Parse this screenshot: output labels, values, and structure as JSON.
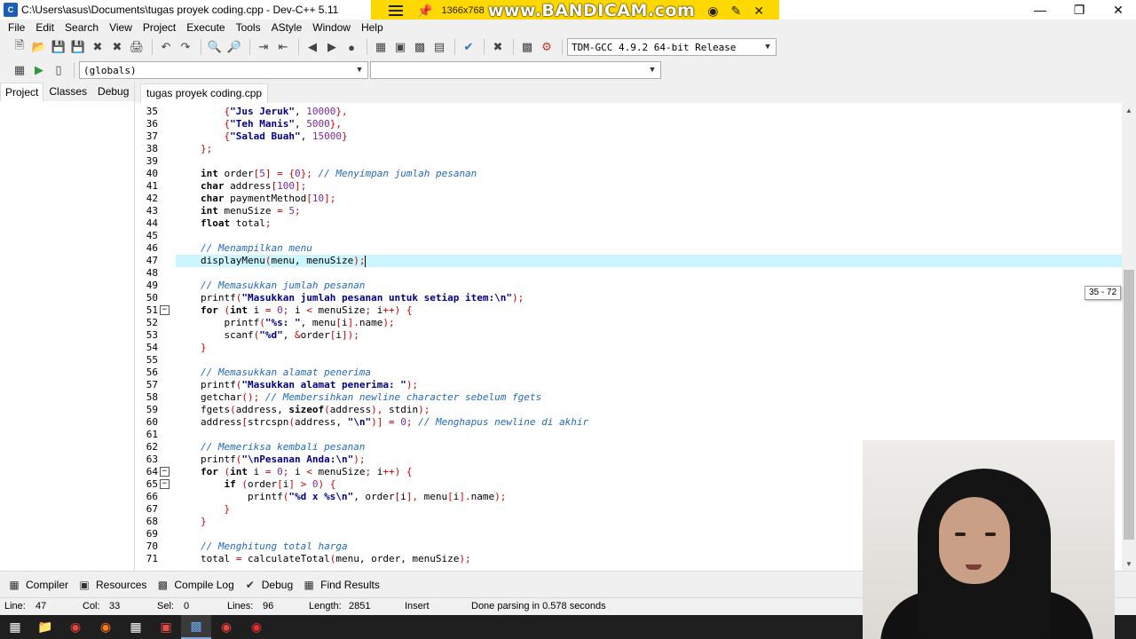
{
  "window": {
    "title": "C:\\Users\\asus\\Documents\\tugas proyek coding.cpp - Dev-C++ 5.11",
    "minimize": "—",
    "maximize": "❐",
    "close": "✕"
  },
  "recorder": {
    "resolution": "1366x768",
    "brand": "www.BANDICAM.com"
  },
  "menu": [
    "File",
    "Edit",
    "Search",
    "View",
    "Project",
    "Execute",
    "Tools",
    "AStyle",
    "Window",
    "Help"
  ],
  "toolbar": {
    "compiler_select": "TDM-GCC 4.9.2 64-bit Release",
    "scope_select": "(globals)",
    "symbol_select": ""
  },
  "left_panel": {
    "tabs": [
      "Project",
      "Classes",
      "Debug"
    ],
    "active_tab": "Project"
  },
  "editor": {
    "file_tab": "tugas proyek coding.cpp",
    "current_line": 47,
    "scroll_tooltip": "35 - 72",
    "lines": [
      {
        "n": 35,
        "indent": 4,
        "fold": "",
        "tokens": [
          {
            "t": "{",
            "c": "sym"
          },
          {
            "t": "\"Jus Jeruk\"",
            "c": "str"
          },
          {
            "t": ", ",
            "c": ""
          },
          {
            "t": "10000",
            "c": "num"
          },
          {
            "t": "},",
            "c": "sym"
          }
        ]
      },
      {
        "n": 36,
        "indent": 4,
        "fold": "",
        "tokens": [
          {
            "t": "{",
            "c": "sym"
          },
          {
            "t": "\"Teh Manis\"",
            "c": "str"
          },
          {
            "t": ", ",
            "c": ""
          },
          {
            "t": "5000",
            "c": "num"
          },
          {
            "t": "},",
            "c": "sym"
          }
        ]
      },
      {
        "n": 37,
        "indent": 4,
        "fold": "",
        "tokens": [
          {
            "t": "{",
            "c": "sym"
          },
          {
            "t": "\"Salad Buah\"",
            "c": "str"
          },
          {
            "t": ", ",
            "c": ""
          },
          {
            "t": "15000",
            "c": "num"
          },
          {
            "t": "}",
            "c": "sym"
          }
        ]
      },
      {
        "n": 38,
        "indent": 0,
        "fold": "",
        "tokens": [
          {
            "t": "};",
            "c": "sym"
          }
        ]
      },
      {
        "n": 39,
        "indent": 0,
        "fold": "",
        "tokens": []
      },
      {
        "n": 40,
        "indent": 0,
        "fold": "",
        "tokens": [
          {
            "t": "int",
            "c": "kw"
          },
          {
            "t": " order",
            "c": ""
          },
          {
            "t": "[",
            "c": "sym"
          },
          {
            "t": "5",
            "c": "num"
          },
          {
            "t": "] = {",
            "c": "sym"
          },
          {
            "t": "0",
            "c": "num"
          },
          {
            "t": "};",
            "c": "sym"
          },
          {
            "t": " // Menyimpan jumlah pesanan",
            "c": "cm"
          }
        ]
      },
      {
        "n": 41,
        "indent": 0,
        "fold": "",
        "tokens": [
          {
            "t": "char",
            "c": "kw"
          },
          {
            "t": " address",
            "c": ""
          },
          {
            "t": "[",
            "c": "sym"
          },
          {
            "t": "100",
            "c": "num"
          },
          {
            "t": "];",
            "c": "sym"
          }
        ]
      },
      {
        "n": 42,
        "indent": 0,
        "fold": "",
        "tokens": [
          {
            "t": "char",
            "c": "kw"
          },
          {
            "t": " paymentMethod",
            "c": ""
          },
          {
            "t": "[",
            "c": "sym"
          },
          {
            "t": "10",
            "c": "num"
          },
          {
            "t": "];",
            "c": "sym"
          }
        ]
      },
      {
        "n": 43,
        "indent": 0,
        "fold": "",
        "tokens": [
          {
            "t": "int",
            "c": "kw"
          },
          {
            "t": " menuSize ",
            "c": ""
          },
          {
            "t": "=",
            "c": "sym"
          },
          {
            "t": " ",
            "c": ""
          },
          {
            "t": "5",
            "c": "num"
          },
          {
            "t": ";",
            "c": "sym"
          }
        ]
      },
      {
        "n": 44,
        "indent": 0,
        "fold": "",
        "tokens": [
          {
            "t": "float",
            "c": "kw"
          },
          {
            "t": " total",
            "c": ""
          },
          {
            "t": ";",
            "c": "sym"
          }
        ]
      },
      {
        "n": 45,
        "indent": 0,
        "fold": "",
        "tokens": []
      },
      {
        "n": 46,
        "indent": 0,
        "fold": "",
        "tokens": [
          {
            "t": "// Menampilkan menu",
            "c": "cm"
          }
        ]
      },
      {
        "n": 47,
        "indent": 0,
        "fold": "",
        "tokens": [
          {
            "t": "displayMenu",
            "c": ""
          },
          {
            "t": "(",
            "c": "sym"
          },
          {
            "t": "menu, menuSize",
            "c": ""
          },
          {
            "t": ");",
            "c": "sym"
          }
        ]
      },
      {
        "n": 48,
        "indent": 0,
        "fold": "",
        "tokens": []
      },
      {
        "n": 49,
        "indent": 0,
        "fold": "",
        "tokens": [
          {
            "t": "// Memasukkan jumlah pesanan",
            "c": "cm"
          }
        ]
      },
      {
        "n": 50,
        "indent": 0,
        "fold": "",
        "tokens": [
          {
            "t": "printf",
            "c": ""
          },
          {
            "t": "(",
            "c": "sym"
          },
          {
            "t": "\"Masukkan jumlah pesanan untuk setiap item:\\n\"",
            "c": "str"
          },
          {
            "t": ");",
            "c": "sym"
          }
        ]
      },
      {
        "n": 51,
        "indent": 0,
        "fold": "−",
        "tokens": [
          {
            "t": "for",
            "c": "kw"
          },
          {
            "t": " ",
            "c": ""
          },
          {
            "t": "(",
            "c": "sym"
          },
          {
            "t": "int",
            "c": "kw"
          },
          {
            "t": " i ",
            "c": ""
          },
          {
            "t": "=",
            "c": "sym"
          },
          {
            "t": " ",
            "c": ""
          },
          {
            "t": "0",
            "c": "num"
          },
          {
            "t": ";",
            "c": "sym"
          },
          {
            "t": " i ",
            "c": ""
          },
          {
            "t": "<",
            "c": "sym"
          },
          {
            "t": " menuSize",
            "c": ""
          },
          {
            "t": ";",
            "c": "sym"
          },
          {
            "t": " i",
            "c": ""
          },
          {
            "t": "++) {",
            "c": "sym"
          }
        ]
      },
      {
        "n": 52,
        "indent": 4,
        "fold": "",
        "tokens": [
          {
            "t": "printf",
            "c": ""
          },
          {
            "t": "(",
            "c": "sym"
          },
          {
            "t": "\"%s: \"",
            "c": "str"
          },
          {
            "t": ", menu",
            "c": ""
          },
          {
            "t": "[",
            "c": "sym"
          },
          {
            "t": "i",
            "c": ""
          },
          {
            "t": "].",
            "c": "sym"
          },
          {
            "t": "name",
            "c": ""
          },
          {
            "t": ");",
            "c": "sym"
          }
        ]
      },
      {
        "n": 53,
        "indent": 4,
        "fold": "",
        "tokens": [
          {
            "t": "scanf",
            "c": ""
          },
          {
            "t": "(",
            "c": "sym"
          },
          {
            "t": "\"%d\"",
            "c": "str"
          },
          {
            "t": ", ",
            "c": ""
          },
          {
            "t": "&",
            "c": "sym"
          },
          {
            "t": "order",
            "c": ""
          },
          {
            "t": "[",
            "c": "sym"
          },
          {
            "t": "i",
            "c": ""
          },
          {
            "t": "]);",
            "c": "sym"
          }
        ]
      },
      {
        "n": 54,
        "indent": 0,
        "fold": "",
        "tokens": [
          {
            "t": "}",
            "c": "sym"
          }
        ]
      },
      {
        "n": 55,
        "indent": 0,
        "fold": "",
        "tokens": []
      },
      {
        "n": 56,
        "indent": 0,
        "fold": "",
        "tokens": [
          {
            "t": "// Memasukkan alamat penerima",
            "c": "cm"
          }
        ]
      },
      {
        "n": 57,
        "indent": 0,
        "fold": "",
        "tokens": [
          {
            "t": "printf",
            "c": ""
          },
          {
            "t": "(",
            "c": "sym"
          },
          {
            "t": "\"Masukkan alamat penerima: \"",
            "c": "str"
          },
          {
            "t": ");",
            "c": "sym"
          }
        ]
      },
      {
        "n": 58,
        "indent": 0,
        "fold": "",
        "tokens": [
          {
            "t": "getchar",
            "c": ""
          },
          {
            "t": "();",
            "c": "sym"
          },
          {
            "t": " // Membersihkan newline character sebelum fgets",
            "c": "cm"
          }
        ]
      },
      {
        "n": 59,
        "indent": 0,
        "fold": "",
        "tokens": [
          {
            "t": "fgets",
            "c": ""
          },
          {
            "t": "(",
            "c": "sym"
          },
          {
            "t": "address, ",
            "c": ""
          },
          {
            "t": "sizeof",
            "c": "kw"
          },
          {
            "t": "(",
            "c": "sym"
          },
          {
            "t": "address",
            "c": ""
          },
          {
            "t": "),",
            "c": "sym"
          },
          {
            "t": " stdin",
            "c": ""
          },
          {
            "t": ");",
            "c": "sym"
          }
        ]
      },
      {
        "n": 60,
        "indent": 0,
        "fold": "",
        "tokens": [
          {
            "t": "address",
            "c": ""
          },
          {
            "t": "[",
            "c": "sym"
          },
          {
            "t": "strcspn",
            "c": ""
          },
          {
            "t": "(",
            "c": "sym"
          },
          {
            "t": "address, ",
            "c": ""
          },
          {
            "t": "\"\\n\"",
            "c": "str"
          },
          {
            "t": ")] = ",
            "c": "sym"
          },
          {
            "t": "0",
            "c": "num"
          },
          {
            "t": ";",
            "c": "sym"
          },
          {
            "t": " // Menghapus newline di akhir",
            "c": "cm"
          }
        ]
      },
      {
        "n": 61,
        "indent": 0,
        "fold": "",
        "tokens": []
      },
      {
        "n": 62,
        "indent": 0,
        "fold": "",
        "tokens": [
          {
            "t": "// Memeriksa kembali pesanan",
            "c": "cm"
          }
        ]
      },
      {
        "n": 63,
        "indent": 0,
        "fold": "",
        "tokens": [
          {
            "t": "printf",
            "c": ""
          },
          {
            "t": "(",
            "c": "sym"
          },
          {
            "t": "\"\\nPesanan Anda:\\n\"",
            "c": "str"
          },
          {
            "t": ");",
            "c": "sym"
          }
        ]
      },
      {
        "n": 64,
        "indent": 0,
        "fold": "−",
        "tokens": [
          {
            "t": "for",
            "c": "kw"
          },
          {
            "t": " ",
            "c": ""
          },
          {
            "t": "(",
            "c": "sym"
          },
          {
            "t": "int",
            "c": "kw"
          },
          {
            "t": " i ",
            "c": ""
          },
          {
            "t": "=",
            "c": "sym"
          },
          {
            "t": " ",
            "c": ""
          },
          {
            "t": "0",
            "c": "num"
          },
          {
            "t": ";",
            "c": "sym"
          },
          {
            "t": " i ",
            "c": ""
          },
          {
            "t": "<",
            "c": "sym"
          },
          {
            "t": " menuSize",
            "c": ""
          },
          {
            "t": ";",
            "c": "sym"
          },
          {
            "t": " i",
            "c": ""
          },
          {
            "t": "++) {",
            "c": "sym"
          }
        ]
      },
      {
        "n": 65,
        "indent": 4,
        "fold": "−",
        "tokens": [
          {
            "t": "if",
            "c": "kw"
          },
          {
            "t": " ",
            "c": ""
          },
          {
            "t": "(",
            "c": "sym"
          },
          {
            "t": "order",
            "c": ""
          },
          {
            "t": "[",
            "c": "sym"
          },
          {
            "t": "i",
            "c": ""
          },
          {
            "t": "] > ",
            "c": "sym"
          },
          {
            "t": "0",
            "c": "num"
          },
          {
            "t": ") {",
            "c": "sym"
          }
        ]
      },
      {
        "n": 66,
        "indent": 8,
        "fold": "",
        "tokens": [
          {
            "t": "printf",
            "c": ""
          },
          {
            "t": "(",
            "c": "sym"
          },
          {
            "t": "\"%d x %s\\n\"",
            "c": "str"
          },
          {
            "t": ", order",
            "c": ""
          },
          {
            "t": "[",
            "c": "sym"
          },
          {
            "t": "i",
            "c": ""
          },
          {
            "t": "],",
            "c": "sym"
          },
          {
            "t": " menu",
            "c": ""
          },
          {
            "t": "[",
            "c": "sym"
          },
          {
            "t": "i",
            "c": ""
          },
          {
            "t": "].",
            "c": "sym"
          },
          {
            "t": "name",
            "c": ""
          },
          {
            "t": ");",
            "c": "sym"
          }
        ]
      },
      {
        "n": 67,
        "indent": 4,
        "fold": "",
        "tokens": [
          {
            "t": "}",
            "c": "sym"
          }
        ]
      },
      {
        "n": 68,
        "indent": 0,
        "fold": "",
        "tokens": [
          {
            "t": "}",
            "c": "sym"
          }
        ]
      },
      {
        "n": 69,
        "indent": 0,
        "fold": "",
        "tokens": []
      },
      {
        "n": 70,
        "indent": 0,
        "fold": "",
        "tokens": [
          {
            "t": "// Menghitung total harga",
            "c": "cm"
          }
        ]
      },
      {
        "n": 71,
        "indent": 0,
        "fold": "",
        "tokens": [
          {
            "t": "total ",
            "c": ""
          },
          {
            "t": "=",
            "c": "sym"
          },
          {
            "t": " calculateTotal",
            "c": ""
          },
          {
            "t": "(",
            "c": "sym"
          },
          {
            "t": "menu, order, menuSize",
            "c": ""
          },
          {
            "t": ");",
            "c": "sym"
          }
        ]
      }
    ]
  },
  "bottom_tabs": [
    {
      "label": "Compiler",
      "icon": "grid-icon"
    },
    {
      "label": "Resources",
      "icon": "resources-icon"
    },
    {
      "label": "Compile Log",
      "icon": "chart-icon"
    },
    {
      "label": "Debug",
      "icon": "check-icon"
    },
    {
      "label": "Find Results",
      "icon": "find-icon"
    }
  ],
  "status": {
    "line_label": "Line:",
    "line_value": "47",
    "col_label": "Col:",
    "col_value": "33",
    "sel_label": "Sel:",
    "sel_value": "0",
    "lines_label": "Lines:",
    "lines_value": "96",
    "length_label": "Length:",
    "length_value": "2851",
    "mode": "Insert",
    "message": "Done parsing in 0.578 seconds"
  }
}
